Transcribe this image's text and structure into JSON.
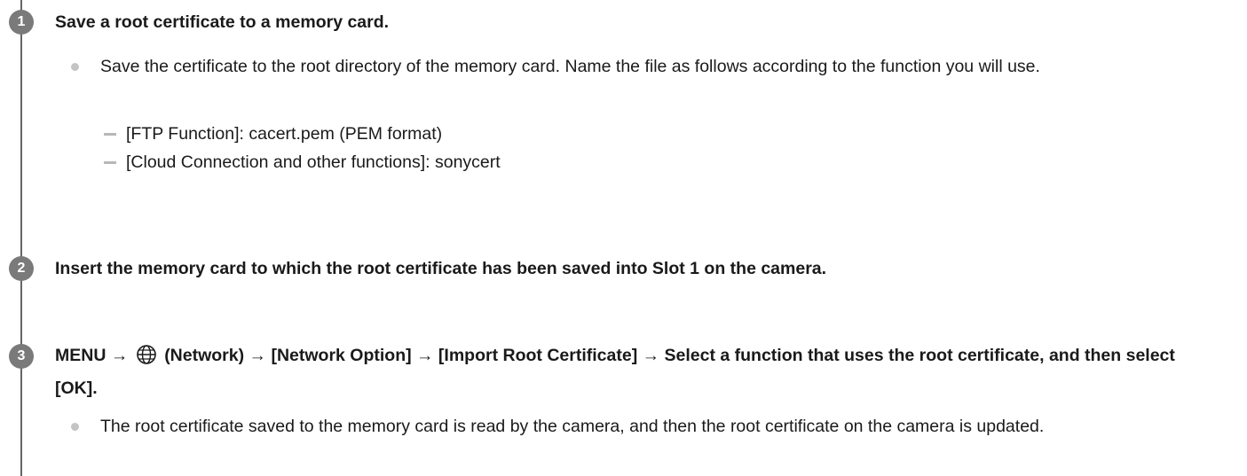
{
  "steps": [
    {
      "number": "1",
      "title": "Save a root certificate to a memory card.",
      "bullets": [
        "Save the certificate to the root directory of the memory card. Name the file as follows according to the function you will use."
      ],
      "subitems": [
        "[FTP Function]: cacert.pem (PEM format)",
        "[Cloud Connection and other functions]: sonycert"
      ]
    },
    {
      "number": "2",
      "title": "Insert the memory card to which the root certificate has been saved into Slot 1 on the camera."
    },
    {
      "number": "3",
      "title_before_icon": "MENU →",
      "icon": "globe-icon",
      "title_after_icon": "(Network) → [Network Option] → [Import Root Certificate] → Select a function that uses the root certificate, and then select [OK].",
      "bullets": [
        "The root certificate saved to the memory card is read by the camera, and then the root certificate on the camera is updated."
      ]
    }
  ],
  "colors": {
    "text": "#1a1a1a",
    "step_circle": "#7a7a7a",
    "timeline": "#666666",
    "bullet": "#c4c4c4",
    "dash": "#b8b8b8"
  }
}
